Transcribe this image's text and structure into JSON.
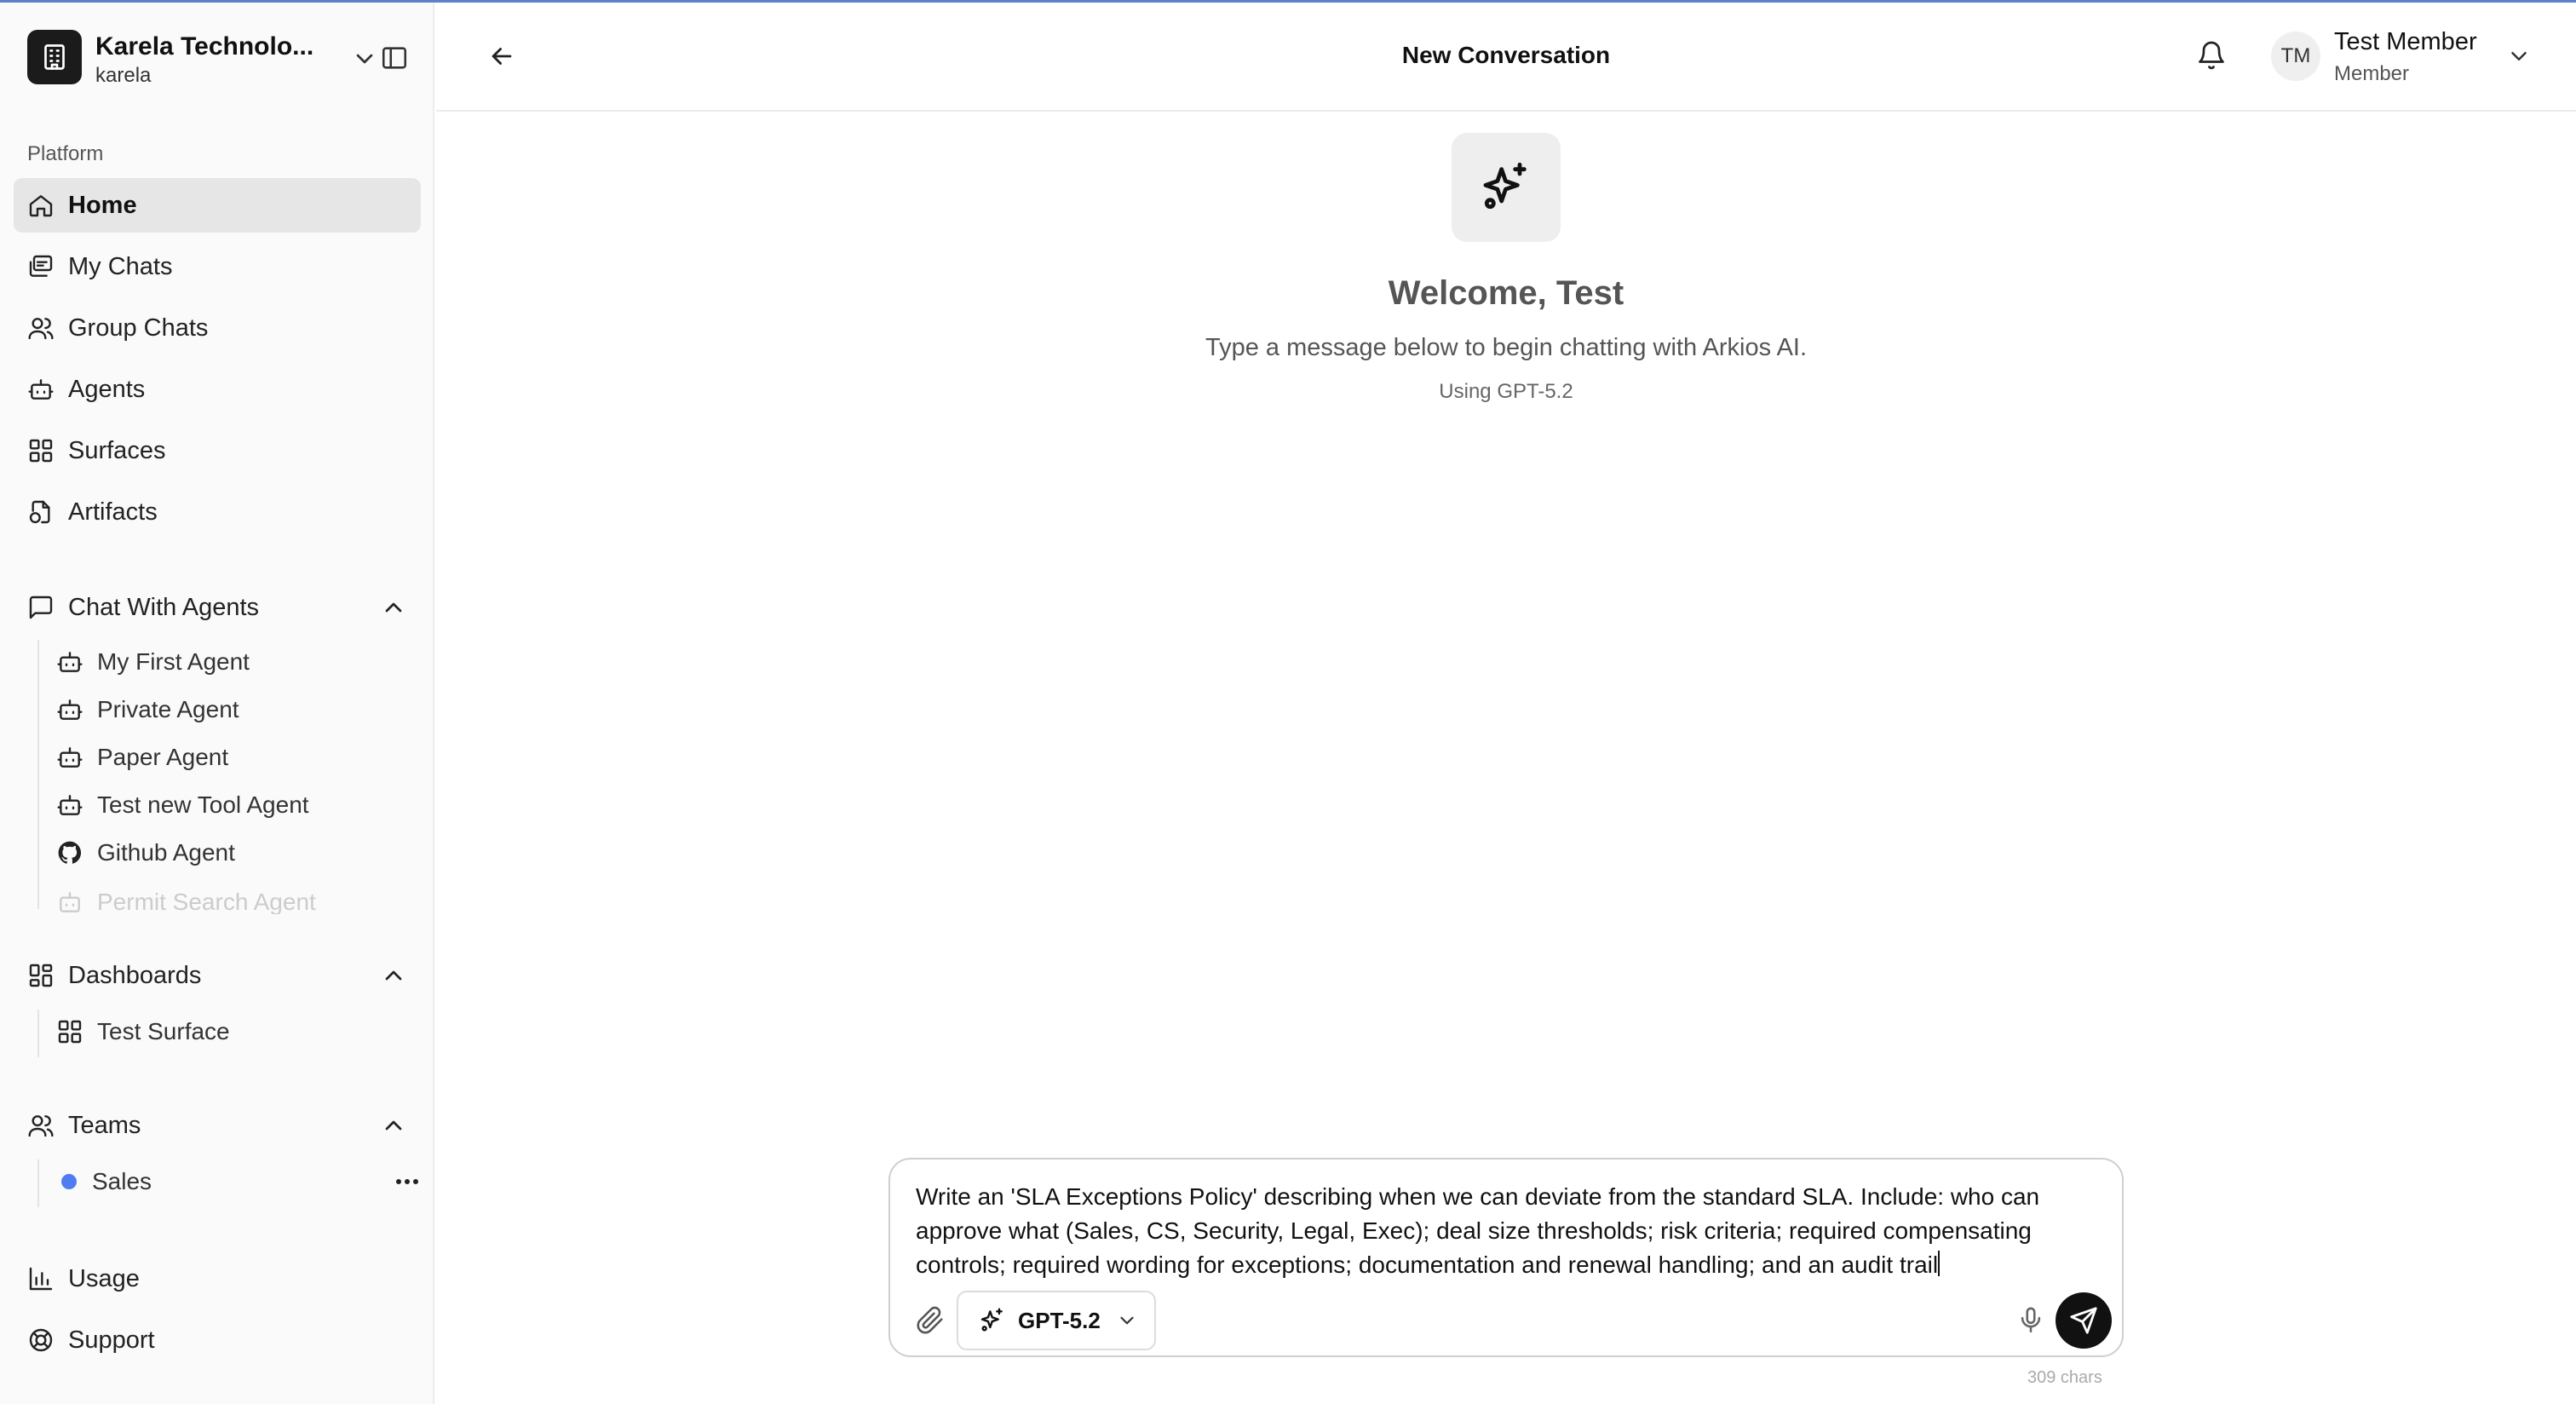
{
  "brand": {
    "name": "Karela Technolo...",
    "slug": "karela",
    "logo_icon": "building-icon"
  },
  "sidebar": {
    "section_label": "Platform",
    "nav": [
      {
        "label": "Home",
        "icon": "home-icon",
        "active": true
      },
      {
        "label": "My Chats",
        "icon": "chats-icon"
      },
      {
        "label": "Group Chats",
        "icon": "users-icon"
      },
      {
        "label": "Agents",
        "icon": "bot-icon"
      },
      {
        "label": "Surfaces",
        "icon": "grid-icon"
      },
      {
        "label": "Artifacts",
        "icon": "file-icon"
      }
    ],
    "chat_with_agents": {
      "label": "Chat With Agents",
      "items": [
        {
          "label": "My First Agent",
          "icon": "bot-icon"
        },
        {
          "label": "Private Agent",
          "icon": "bot-icon"
        },
        {
          "label": "Paper Agent",
          "icon": "bot-icon"
        },
        {
          "label": "Test new Tool Agent",
          "icon": "bot-icon"
        },
        {
          "label": "Github Agent",
          "icon": "github-icon"
        },
        {
          "label": "Permit Search Agent",
          "icon": "bot-icon"
        }
      ]
    },
    "dashboards": {
      "label": "Dashboards",
      "items": [
        {
          "label": "Test Surface",
          "icon": "grid-icon"
        }
      ]
    },
    "teams": {
      "label": "Teams",
      "items": [
        {
          "label": "Sales",
          "color": "#4f7cf0"
        }
      ]
    },
    "footer": [
      {
        "label": "Usage",
        "icon": "bar-chart-icon"
      },
      {
        "label": "Support",
        "icon": "lifebuoy-icon"
      }
    ]
  },
  "header": {
    "title": "New Conversation",
    "user": {
      "initials": "TM",
      "name": "Test Member",
      "role": "Member"
    }
  },
  "main": {
    "welcome_title": "Welcome, Test",
    "welcome_subtitle": "Type a message below to begin chatting with Arkios AI.",
    "model_note": "Using GPT-5.2"
  },
  "composer": {
    "text": "Write an 'SLA Exceptions Policy' describing when we can deviate from the standard SLA. Include: who can approve what (Sales, CS, Security, Legal, Exec); deal size thresholds; risk criteria; required compensating controls; required wording for exceptions; documentation and renewal handling; and an audit trail",
    "model": "GPT-5.2",
    "char_count": "309 chars"
  }
}
